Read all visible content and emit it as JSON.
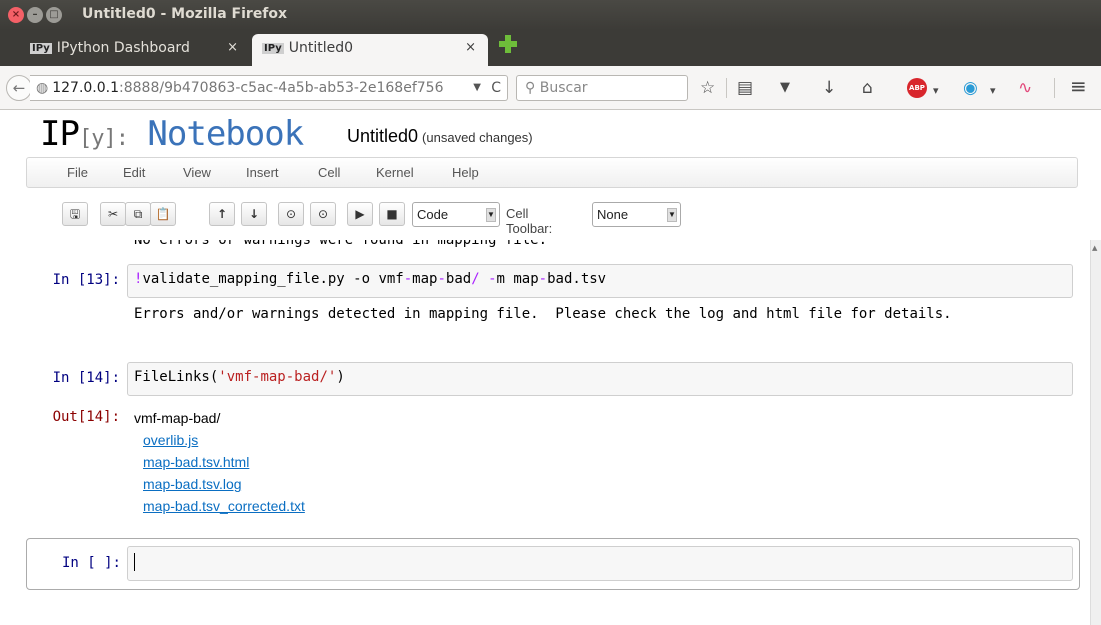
{
  "window": {
    "title": "Untitled0 - Mozilla Firefox",
    "close_symbol": "×",
    "min_symbol": "–",
    "max_symbol": "□"
  },
  "tabs": [
    {
      "badge": "IPy",
      "label": "IPython Dashboard",
      "close": "×",
      "active": false
    },
    {
      "badge": "IPy",
      "label": "Untitled0",
      "close": "×",
      "active": true
    }
  ],
  "nav": {
    "back_symbol": "←",
    "url_host": "127.0.0.1",
    "url_rest": ":8888/9b470863-c5ac-4a5b-ab53-2e168ef756",
    "url_drop_symbol": "▼",
    "reload_symbol": "C",
    "search_placeholder": "Buscar",
    "search_symbol": "⚲",
    "icons": [
      {
        "name": "bookmark-star-icon",
        "glyph": "☆"
      },
      {
        "name": "reading-list-icon",
        "glyph": "▤"
      },
      {
        "name": "pocket-icon",
        "glyph": "▼"
      },
      {
        "name": "download-icon",
        "glyph": "↓"
      },
      {
        "name": "home-icon",
        "glyph": "⌂"
      },
      {
        "name": "addon-globe-icon",
        "glyph": "◉"
      },
      {
        "name": "addon-chart-icon",
        "glyph": "∿"
      },
      {
        "name": "menu-icon",
        "glyph": "≡"
      }
    ],
    "abp_label": "ABP",
    "dropdown_symbol": "▾"
  },
  "notebook": {
    "logo_ip": "IP",
    "logo_y": "[y]:",
    "logo_nb": "Notebook",
    "name": "Untitled0",
    "status": "(unsaved changes)"
  },
  "menu": [
    "File",
    "Edit",
    "View",
    "Insert",
    "Cell",
    "Kernel",
    "Help"
  ],
  "toolbar": {
    "buttons": [
      {
        "name": "save-button",
        "glyph": "🖫"
      },
      {
        "name": "cut-button",
        "glyph": "✂"
      },
      {
        "name": "copy-button",
        "glyph": "⧉"
      },
      {
        "name": "paste-button",
        "glyph": "📋"
      },
      {
        "name": "move-up-button",
        "glyph": "↑"
      },
      {
        "name": "move-down-button",
        "glyph": "↓"
      },
      {
        "name": "insert-above-button",
        "glyph": "⊙"
      },
      {
        "name": "insert-below-button",
        "glyph": "⊙"
      },
      {
        "name": "run-button",
        "glyph": "▶"
      },
      {
        "name": "stop-button",
        "glyph": "■"
      }
    ],
    "cell_type": "Code",
    "cell_toolbar_label": "Cell Toolbar:",
    "cell_toolbar_value": "None",
    "select_arrow": "▼"
  },
  "cells": {
    "cut_text": "No errors or warnings were found in mapping file.",
    "c13": {
      "prompt": "In [13]:",
      "code_bang": "!",
      "code_a": "validate_mapping_file.py -o vmf",
      "code_dash1": "-",
      "code_b": "map",
      "code_dash2": "-",
      "code_c": "bad",
      "code_slash": "/",
      "code_d": " ",
      "code_dash3": "-",
      "code_e": "m ",
      "code_f": "map",
      "code_dash4": "-",
      "code_g": "bad.tsv",
      "output": "Errors and/or warnings detected in mapping file.  Please check the log and html file for details."
    },
    "c14": {
      "prompt": "In [14]:",
      "code_fn": "FileLinks",
      "code_open": "(",
      "code_str": "'vmf-map-bad/'",
      "code_close": ")",
      "out_prompt": "Out[14]:",
      "dir": "vmf-map-bad/",
      "links": [
        "overlib.js",
        "map-bad.tsv.html",
        "map-bad.tsv.log",
        "map-bad.tsv_corrected.txt"
      ]
    },
    "empty": {
      "prompt": "In [ ]:"
    }
  }
}
